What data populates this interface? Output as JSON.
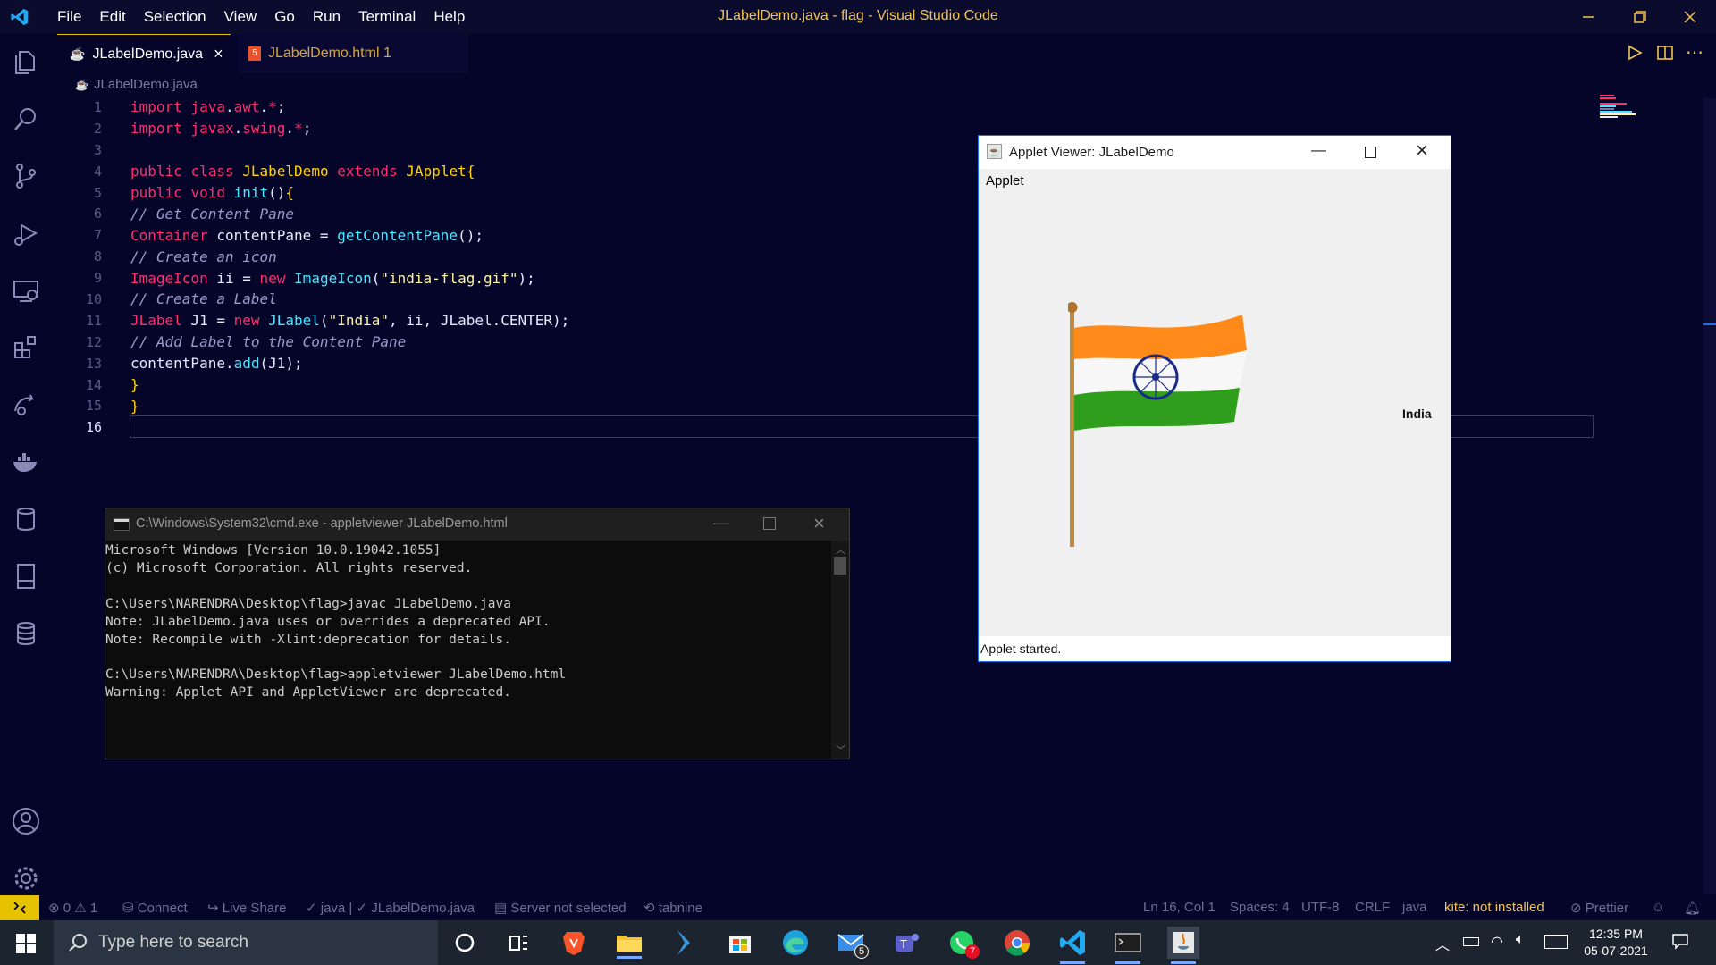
{
  "titlebar": {
    "menu": [
      "File",
      "Edit",
      "Selection",
      "View",
      "Go",
      "Run",
      "Terminal",
      "Help"
    ],
    "title": "JLabelDemo.java - flag - Visual Studio Code"
  },
  "tabs": [
    {
      "label": "JLabelDemo.java",
      "active": true
    },
    {
      "label": "JLabelDemo.html 1",
      "active": false
    }
  ],
  "breadcrumb": "JLabelDemo.java",
  "code": [
    {
      "n": "1",
      "text": "import java.awt.*;"
    },
    {
      "n": "2",
      "text": "import javax.swing.*;"
    },
    {
      "n": "3",
      "text": ""
    },
    {
      "n": "4",
      "text": "public class JLabelDemo extends JApplet{"
    },
    {
      "n": "5",
      "text": "public void init(){"
    },
    {
      "n": "6",
      "text": "// Get Content Pane"
    },
    {
      "n": "7",
      "text": "Container contentPane = getContentPane();"
    },
    {
      "n": "8",
      "text": "// Create an icon"
    },
    {
      "n": "9",
      "text": "ImageIcon ii = new ImageIcon(\"india-flag.gif\");"
    },
    {
      "n": "10",
      "text": "// Create a Label"
    },
    {
      "n": "11",
      "text": "JLabel J1 = new JLabel(\"India\", ii, JLabel.CENTER);"
    },
    {
      "n": "12",
      "text": "// Add Label to the Content Pane"
    },
    {
      "n": "13",
      "text": "contentPane.add(J1);"
    },
    {
      "n": "14",
      "text": "}"
    },
    {
      "n": "15",
      "text": "}"
    },
    {
      "n": "16",
      "text": ""
    }
  ],
  "cmd": {
    "title": "C:\\Windows\\System32\\cmd.exe - appletviewer  JLabelDemo.html",
    "output": "Microsoft Windows [Version 10.0.19042.1055]\n(c) Microsoft Corporation. All rights reserved.\n\nC:\\Users\\NARENDRA\\Desktop\\flag>javac JLabelDemo.java\nNote: JLabelDemo.java uses or overrides a deprecated API.\nNote: Recompile with -Xlint:deprecation for details.\n\nC:\\Users\\NARENDRA\\Desktop\\flag>appletviewer JLabelDemo.html\nWarning: Applet API and AppletViewer are deprecated."
  },
  "applet": {
    "title": "Applet Viewer: JLabelDemo",
    "menu": "Applet",
    "label": "India",
    "status": "Applet started."
  },
  "statusbar": {
    "problems": "0",
    "warnings": "1",
    "connect": "Connect",
    "liveshare": "Live Share",
    "java": "java | ✓ JLabelDemo.java",
    "server": "Server not selected",
    "tabnine": "tabnine",
    "position": "Ln 16, Col 1",
    "spaces": "Spaces: 4",
    "encoding": "UTF-8",
    "eol": "CRLF",
    "language": "java",
    "kite": "kite: not installed",
    "prettier": "Prettier"
  },
  "taskbar": {
    "search_placeholder": "Type here to search",
    "time": "12:35 PM",
    "date": "05-07-2021",
    "mail_badge": "5",
    "whatsapp_badge": "7"
  },
  "colors": {
    "accent": "#f0c350",
    "keyword": "#ff2e6e",
    "function": "#4be6ff",
    "background": "#05052a"
  }
}
